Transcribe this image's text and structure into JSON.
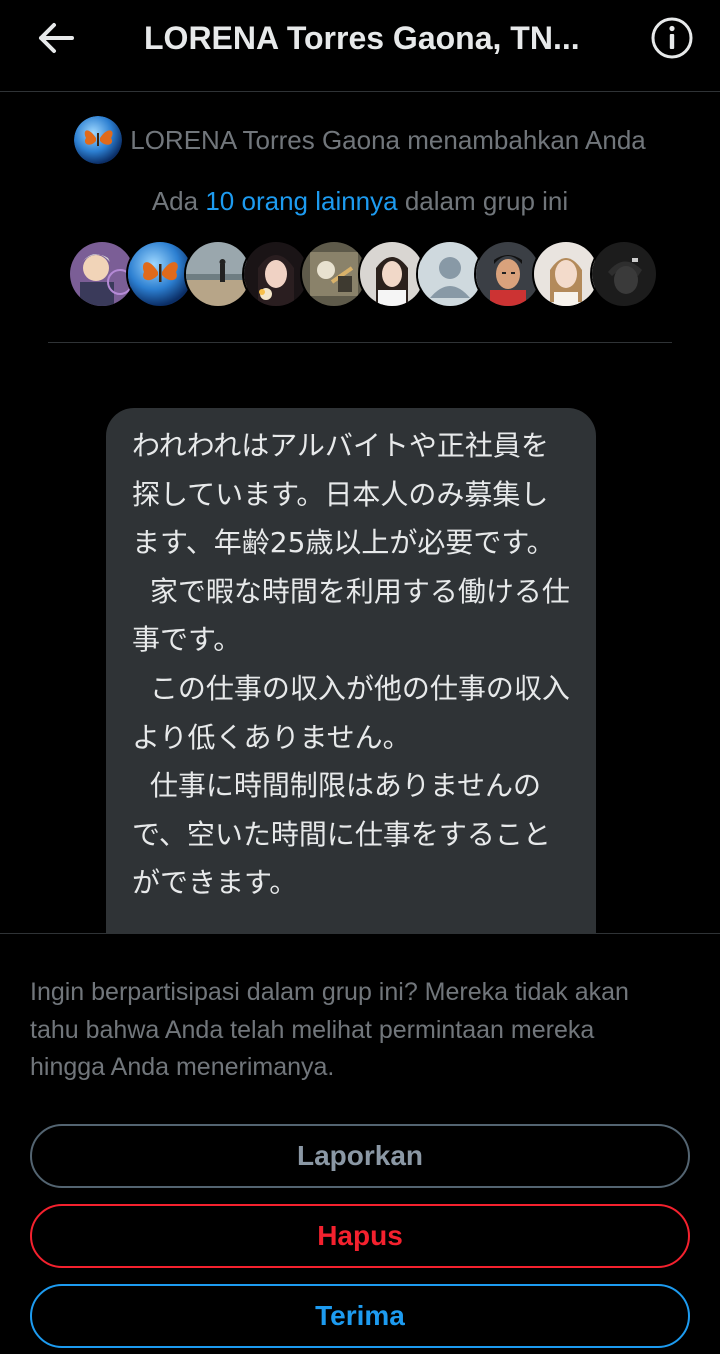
{
  "header": {
    "title": "LORENA Torres Gaona, TN...",
    "back_icon": "arrow-left-icon",
    "info_icon": "info-circle-icon"
  },
  "group_intro": {
    "added_by_text": "LORENA Torres Gaona menambahkan Anda",
    "members_prefix": "Ada ",
    "members_link": "10 orang lainnya",
    "members_suffix": " dalam grup ini"
  },
  "message": {
    "text": "われわれはアルバイトや正社員を探しています。日本人のみ募集します、年齢25歳以上が必要です。\n  家で暇な時間を利用する働ける仕事です。\n  この仕事の収入が他の仕事の収入より低くありません。\n  仕事に時間制限はありませんので、空いた時間に仕事をすることができます。"
  },
  "request_panel": {
    "prompt": "Ingin berpartisipasi dalam grup ini? Mereka tidak akan tahu bahwa Anda telah melihat permintaan mereka hingga Anda menerimanya.",
    "report_label": "Laporkan",
    "delete_label": "Hapus",
    "accept_label": "Terima"
  },
  "colors": {
    "background": "#000000",
    "bubble": "#2f3336",
    "accent": "#1d9bf0",
    "danger": "#f4212e",
    "muted": "#71767b"
  }
}
